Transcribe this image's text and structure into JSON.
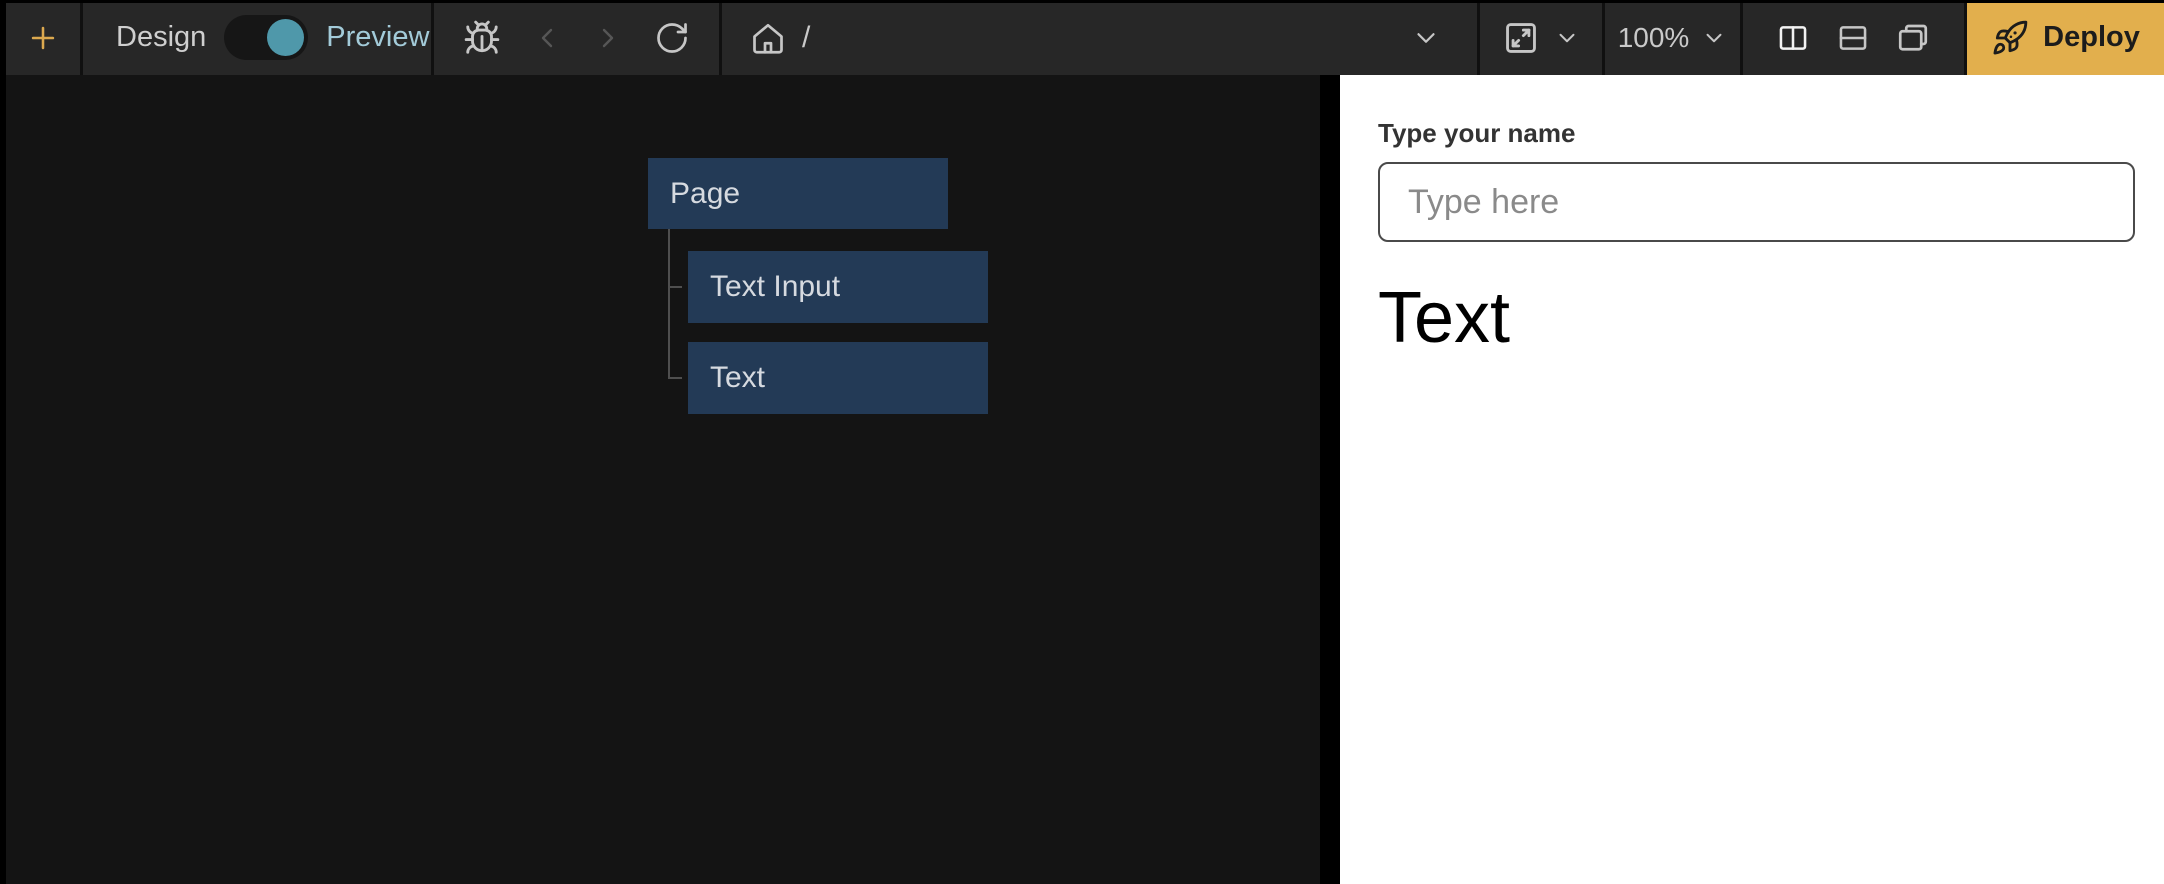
{
  "toolbar": {
    "add_tooltip": "+",
    "mode_toggle": {
      "design_label": "Design",
      "preview_label": "Preview",
      "active_mode": "Preview"
    },
    "icons": [
      "plus-icon",
      "bug-icon",
      "chevron-left-icon",
      "chevron-right-icon",
      "refresh-icon",
      "home-icon",
      "chevron-down-icon",
      "device-expand-icon",
      "columns-layout-icon",
      "rows-layout-icon",
      "stack-layout-icon",
      "rocket-icon"
    ],
    "path": "/",
    "zoom_level": "100%",
    "deploy_label": "Deploy"
  },
  "canvas": {
    "tree": {
      "root": {
        "label": "Page"
      },
      "children": [
        {
          "label": "Text Input"
        },
        {
          "label": "Text"
        }
      ]
    }
  },
  "preview": {
    "field_label": "Type your name",
    "input_placeholder": "Type here",
    "input_value": "",
    "text_content": "Text"
  },
  "colors": {
    "toolbar_bg": "#272727",
    "canvas_bg": "#141414",
    "accent_amber": "#dca94f",
    "deploy_bg": "#e2af4d",
    "toggle_knob_teal": "#4f98aa",
    "preview_label_teal": "#a3cbd9",
    "tree_node_bg": "#233a56",
    "panel_bg": "#ffffff"
  }
}
